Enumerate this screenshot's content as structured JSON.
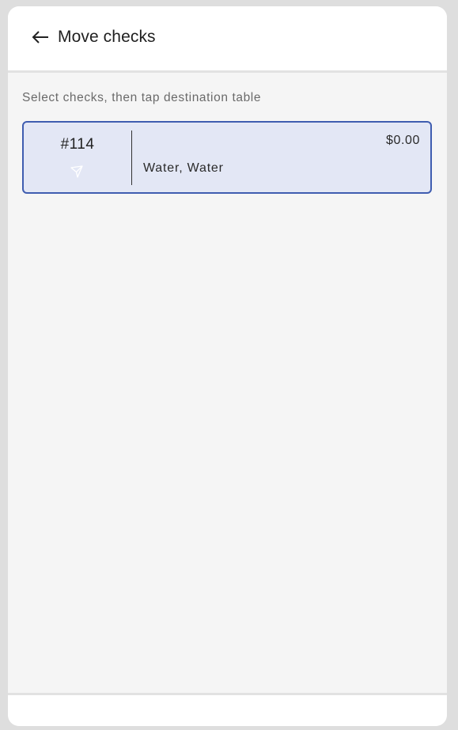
{
  "header": {
    "title": "Move checks",
    "back_icon": "arrow-left-icon"
  },
  "instructions": "Select checks, then tap destination table",
  "checks": [
    {
      "number": "#114",
      "status_icon": "send-icon",
      "amount": "$0.00",
      "items": "Water, Water",
      "selected": true
    }
  ],
  "colors": {
    "selected_border": "#3f5db0",
    "selected_background": "#e3e7f5",
    "page_background": "#f5f5f5"
  }
}
